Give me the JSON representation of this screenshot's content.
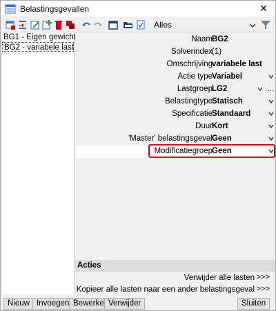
{
  "window": {
    "title": "Belastingsgevallen",
    "close_glyph": "✕"
  },
  "toolbar": {
    "filter_label": "Alles",
    "icons": [
      "new-icon",
      "insert-icon",
      "edit-icon",
      "add-icon",
      "delete-icon",
      "copy-icon",
      "undo-icon",
      "redo-icon",
      "table-icon",
      "open-folder-icon",
      "check-icon",
      "funnel-icon"
    ]
  },
  "list": {
    "items": [
      {
        "label": "BG1 - Eigen gewicht"
      },
      {
        "label": "BG2 - variabele last"
      }
    ]
  },
  "properties": {
    "naam": {
      "label": "Naam",
      "value": "BG2"
    },
    "solverindex": {
      "label": "Solverindex",
      "value": "(1)"
    },
    "omschrijving": {
      "label": "Omschrijving",
      "value": "variabele last"
    },
    "actie_type": {
      "label": "Actie type",
      "value": "Variabel"
    },
    "lastgroep": {
      "label": "Lastgroep",
      "value": "LG2",
      "more": "..."
    },
    "belastingtype": {
      "label": "Belastingtype",
      "value": "Statisch"
    },
    "specificatie": {
      "label": "Specificatie",
      "value": "Standaard"
    },
    "duur": {
      "label": "Duur",
      "value": "Kort"
    },
    "master": {
      "label": "'Master' belastingsgeval",
      "value": "Geen"
    },
    "modificatiegroep": {
      "label": "Modificatiegroep",
      "value": "Geen"
    }
  },
  "acties": {
    "header": "Acties",
    "rows": [
      {
        "label": "Verwijder alle lasten",
        "action": ">>>"
      },
      {
        "label": "Kopieer alle lasten naar een ander belastingsgeval",
        "action": ">>>"
      }
    ]
  },
  "buttons": {
    "nieuw": "Nieuw",
    "invoegen": "Invoegen",
    "bewerken": "Bewerken",
    "verwijder": "Verwijder",
    "sluiten": "Sluiten"
  },
  "colors": {
    "highlight_border": "#d9001b",
    "accent_blue": "#2a6fd1"
  }
}
